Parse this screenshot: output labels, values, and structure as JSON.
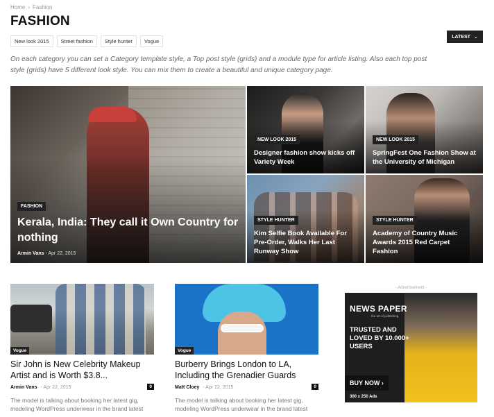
{
  "breadcrumb": {
    "items": [
      "Home",
      "Fashion"
    ],
    "separator": "›"
  },
  "page_title": "FASHION",
  "subcategories": [
    "New look 2015",
    "Street fashion",
    "Style hunter",
    "Vogue"
  ],
  "sort": {
    "label": "LATEST",
    "icon": "chevron-down-icon"
  },
  "description": "On each category you can set a Category template style, a Top post style (grids) and a module type for article listing. Also each top post style (grids) have 5 different look style. You can mix them to create a beautiful and unique category page.",
  "featured": [
    {
      "tag": "FASHION",
      "title": "Kerala, India: They call it Own Country for nothing",
      "author": "Armin Vans",
      "date": "Apr 22, 2015"
    },
    {
      "tag": "NEW LOOK 2015",
      "title": "Designer fashion show kicks off Variety Week"
    },
    {
      "tag": "NEW LOOK 2015",
      "title": "SpringFest One Fashion Show at the University of Michigan"
    },
    {
      "tag": "STYLE HUNTER",
      "title": "Kim Selfie Book Available For Pre-Order, Walks Her Last Runway Show"
    },
    {
      "tag": "STYLE HUNTER",
      "title": "Academy of Country Music Awards 2015 Red Carpet Fashion"
    }
  ],
  "articles": [
    {
      "tag": "Vogue",
      "title": "Sir John is New Celebrity Makeup Artist and is Worth $3.8...",
      "author": "Armin Vans",
      "date": "Apr 22, 2015",
      "comments": "0",
      "excerpt": "The model is talking about booking her latest gig, modeling WordPress underwear in the brand latest"
    },
    {
      "tag": "Vogue",
      "title": "Burberry Brings London to LA, Including the Grenadier Guards",
      "author": "Matt Cloey",
      "date": "Apr 22, 2015",
      "comments": "0",
      "excerpt": "The model is talking about booking her latest gig, modeling WordPress underwear in the brand latest"
    }
  ],
  "ad": {
    "label": "- Advertisement -",
    "brand": "NEWS PAPER",
    "brand_sub": "the art of publishing",
    "tagline": "TRUSTED AND LOVED BY 10.000+ USERS",
    "cta": "BUY NOW ›",
    "size": "300 x 250 Ads"
  }
}
